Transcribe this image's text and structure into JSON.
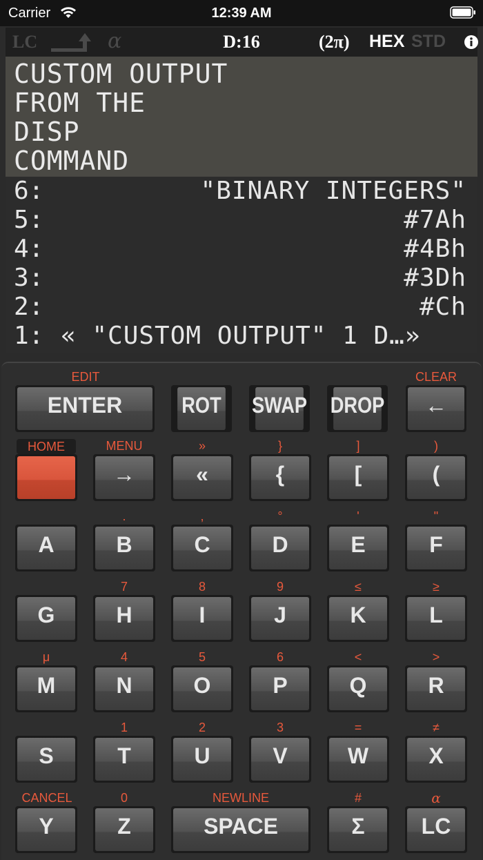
{
  "status_bar": {
    "carrier": "Carrier",
    "time": "12:39 AM"
  },
  "header": {
    "lc_indicator": "LC",
    "alpha_indicator": "α",
    "digits": "D:16",
    "angle_mode": "(2π)",
    "base": "HEX",
    "display_mode": "STD"
  },
  "message": {
    "lines": [
      "CUSTOM OUTPUT",
      "FROM THE",
      "DISP",
      "COMMAND"
    ]
  },
  "stack": [
    {
      "level": "6:",
      "value": "\"BINARY INTEGERS\""
    },
    {
      "level": "5:",
      "value": "#7Ah"
    },
    {
      "level": "4:",
      "value": "#4Bh"
    },
    {
      "level": "3:",
      "value": "#3Dh"
    },
    {
      "level": "2:",
      "value": "#Ch"
    },
    {
      "level": "1:",
      "value": "« \"CUSTOM OUTPUT\" 1 D…»"
    }
  ],
  "keys": {
    "row1": [
      {
        "label": "ENTER",
        "shift": "EDIT"
      },
      {
        "label": "ROT",
        "shift": ""
      },
      {
        "label": "SWAP",
        "shift": ""
      },
      {
        "label": "DROP",
        "shift": ""
      },
      {
        "label": "←",
        "shift": "CLEAR"
      }
    ],
    "row2": [
      {
        "label": "",
        "shift": "HOME"
      },
      {
        "label": "→",
        "shift": "MENU"
      },
      {
        "label": "«",
        "shift": "»"
      },
      {
        "label": "{",
        "shift": "}"
      },
      {
        "label": "[",
        "shift": "]"
      },
      {
        "label": "(",
        "shift": ")"
      }
    ],
    "row3": [
      {
        "label": "A",
        "shift": ""
      },
      {
        "label": "B",
        "shift": "."
      },
      {
        "label": "C",
        "shift": ","
      },
      {
        "label": "D",
        "shift": "°"
      },
      {
        "label": "E",
        "shift": "'"
      },
      {
        "label": "F",
        "shift": "\""
      }
    ],
    "row4": [
      {
        "label": "G",
        "shift": ""
      },
      {
        "label": "H",
        "shift": "7"
      },
      {
        "label": "I",
        "shift": "8"
      },
      {
        "label": "J",
        "shift": "9"
      },
      {
        "label": "K",
        "shift": "≤"
      },
      {
        "label": "L",
        "shift": "≥"
      }
    ],
    "row5": [
      {
        "label": "M",
        "shift": "μ"
      },
      {
        "label": "N",
        "shift": "4"
      },
      {
        "label": "O",
        "shift": "5"
      },
      {
        "label": "P",
        "shift": "6"
      },
      {
        "label": "Q",
        "shift": "<"
      },
      {
        "label": "R",
        "shift": ">"
      }
    ],
    "row6": [
      {
        "label": "S",
        "shift": ""
      },
      {
        "label": "T",
        "shift": "1"
      },
      {
        "label": "U",
        "shift": "2"
      },
      {
        "label": "V",
        "shift": "3"
      },
      {
        "label": "W",
        "shift": "="
      },
      {
        "label": "X",
        "shift": "≠"
      }
    ],
    "row7": [
      {
        "label": "Y",
        "shift": "CANCEL"
      },
      {
        "label": "Z",
        "shift": "0"
      },
      {
        "label": "SPACE",
        "shift": "NEWLINE"
      },
      {
        "label": "Σ",
        "shift": "#"
      },
      {
        "label": "LC",
        "shift": "α"
      }
    ]
  },
  "colors": {
    "shift_label": "#e8593c",
    "home_key": "#d9553c",
    "message_bg": "#4a4944",
    "stack_bg": "#2c2c2c"
  }
}
